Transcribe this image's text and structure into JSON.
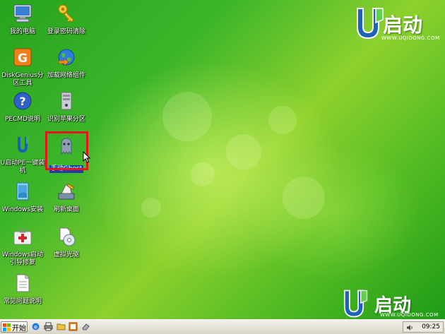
{
  "desktop": {
    "icons": [
      {
        "label": "我的电脑",
        "icon": "my-computer-icon"
      },
      {
        "label": "登录密码清除",
        "icon": "key-icon"
      },
      {
        "label": "DiskGenius分区工具",
        "icon": "diskgenius-icon"
      },
      {
        "label": "加载网络组件",
        "icon": "network-globe-icon"
      },
      {
        "label": "PECMD说明",
        "icon": "help-icon"
      },
      {
        "label": "识别苹果分区",
        "icon": "drive-icon"
      },
      {
        "label": "U启动PE一键装机",
        "icon": "u-qidong-icon"
      },
      {
        "label": "手动Ghost",
        "icon": "ghost-icon",
        "selected": true
      },
      {
        "label": "Windows安装",
        "icon": "windows-install-icon"
      },
      {
        "label": "刷新桌面",
        "icon": "refresh-desktop-icon"
      },
      {
        "label": "Windows启动引导修复",
        "icon": "boot-repair-icon"
      },
      {
        "label": "虚拟光驱",
        "icon": "virtual-cd-icon"
      },
      {
        "label": "常见问题说明",
        "icon": "document-icon"
      }
    ]
  },
  "logo_top": {
    "brand": "启动",
    "url": "WWW.UQIDONG.COM"
  },
  "logo_bottom": {
    "brand": "启动",
    "url": "WWW.UQIDONG.COM"
  },
  "taskbar": {
    "start_label": "开始",
    "quick_launch": [
      "ie-icon",
      "printer-icon",
      "folder-icon",
      "ghost-tray-icon",
      "eraser-icon"
    ],
    "clock": "09:25"
  },
  "colors": {
    "selection_box": "#e8141c",
    "desktop_green": "#3cb52a",
    "highlight": "#1a3fa8"
  }
}
